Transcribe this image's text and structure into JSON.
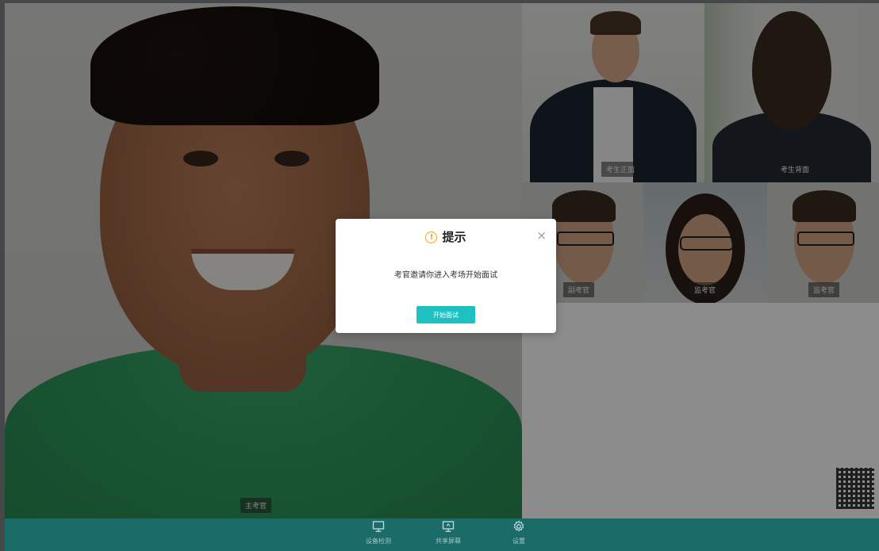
{
  "main_video": {
    "label": "主考官"
  },
  "tiles": [
    {
      "label": "考生正面"
    },
    {
      "label": "考生背面"
    },
    {
      "label": "副考官"
    },
    {
      "label": "监考官"
    },
    {
      "label": "监考官"
    }
  ],
  "toolbar": {
    "items": [
      {
        "label": "设备检测",
        "icon": "monitor-icon"
      },
      {
        "label": "共享屏幕",
        "icon": "screen-share-icon"
      },
      {
        "label": "设置",
        "icon": "gear-icon"
      }
    ]
  },
  "dialog": {
    "title": "提示",
    "message": "考官邀请你进入考场开始面试",
    "button_label": "开始面试",
    "close_symbol": "×",
    "info_symbol": "!"
  },
  "colors": {
    "toolbar_bg": "#1b6b69",
    "button_bg": "#1ec1c0",
    "info_icon": "#f0a020"
  }
}
